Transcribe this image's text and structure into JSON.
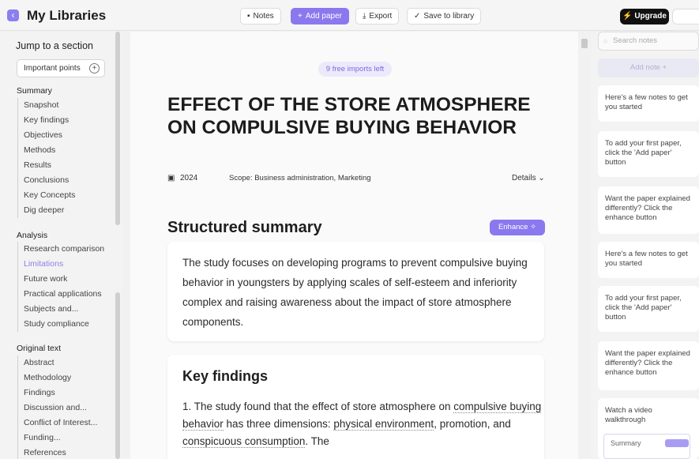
{
  "header": {
    "back_icon": "chevron-left-icon",
    "title": "My Libraries",
    "notes_label": "Notes",
    "add_paper_label": "Add paper",
    "export_label": "Export",
    "save_label": "Save to library",
    "upgrade_label": "Upgrade",
    "accent_color": "#8a78ee"
  },
  "sidebar": {
    "jump_label": "Jump to a section",
    "important_points": "Important points",
    "sections": [
      {
        "heading": "Summary",
        "items": [
          "Snapshot",
          "Key findings",
          "Objectives",
          "Methods",
          "Results",
          "Conclusions",
          "Key Concepts",
          "Dig deeper"
        ]
      },
      {
        "heading": "Analysis",
        "items": [
          "Research comparison",
          "Limitations",
          "Future work",
          "Practical applications",
          "Subjects and...",
          "Study compliance"
        ]
      },
      {
        "heading": "Original text",
        "items": [
          "Abstract",
          "Methodology",
          "Findings",
          "Discussion and...",
          "Conflict of Interest...",
          "Funding...",
          "References"
        ]
      }
    ],
    "active_item": "Limitations"
  },
  "document": {
    "free_imports": "9 free imports left",
    "title": "EFFECT OF THE STORE ATMOSPHERE ON COMPULSIVE BUYING BEHAVIOR",
    "year": "2024",
    "scope": "Scope: Business administration, Marketing",
    "details_label": "Details",
    "structured_summary_heading": "Structured summary",
    "enhance_label": "Enhance",
    "summary_text": "The study focuses on developing programs to prevent compulsive buying behavior in youngsters by applying scales of self-esteem and inferiority complex and raising awareness about the impact of store atmosphere components.",
    "key_findings_heading": "Key findings",
    "kf_prefix": "1. The study found that the effect of store atmosphere on ",
    "kf_term1": "compulsive buying behavior",
    "kf_mid1": " has three dimensions: ",
    "kf_term2": "physical environment",
    "kf_mid2": ", promotion, and ",
    "kf_term3": "conspicuous consumption",
    "kf_suffix": ". The"
  },
  "notes": {
    "search_placeholder": "Search notes",
    "add_note_label": "Add note +",
    "items": [
      "Here's a few notes to get you started",
      "To add your first paper, click the 'Add paper' button",
      "Want the paper explained differently? Click the enhance button",
      "Here's a few notes to get you started",
      "To add your first paper, click the 'Add paper' button",
      "Want the paper explained differently? Click the enhance button",
      "Watch a video walkthrough"
    ],
    "mini_summary_label": "Summary"
  }
}
